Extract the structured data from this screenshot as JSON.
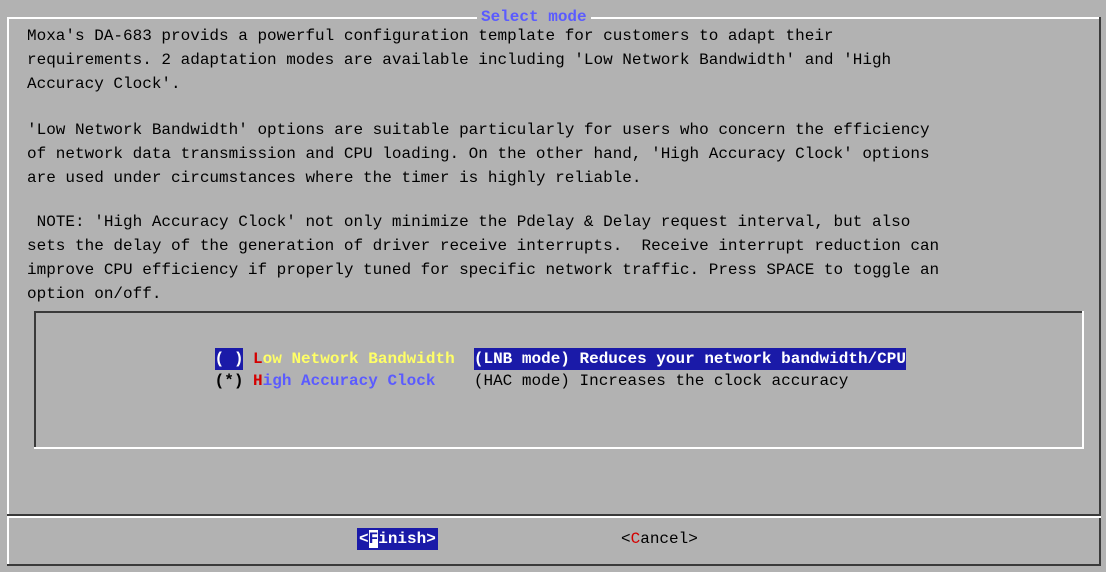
{
  "dialog": {
    "title": "Select mode",
    "paragraph1": "Moxa's DA-683 provids a powerful configuration template for customers to adapt their\nrequirements. 2 adaptation modes are available including 'Low Network Bandwidth' and 'High\nAccuracy Clock'.",
    "paragraph2": "'Low Network Bandwidth' options are suitable particularly for users who concern the efficiency\nof network data transmission and CPU loading. On the other hand, 'High Accuracy Clock' options\nare used under circumstances where the timer is highly reliable.",
    "paragraph3": " NOTE: 'High Accuracy Clock' not only minimize the Pdelay & Delay request interval, but also\nsets the delay of the generation of driver receive interrupts.  Receive interrupt reduction can\nimprove CPU efficiency if properly tuned for specific network traffic. Press SPACE to toggle an\noption on/off."
  },
  "options": [
    {
      "mark": "( )",
      "hotkey": "L",
      "label_rest": "ow Network Bandwidth",
      "description": "(LNB mode) Reduces your network bandwidth/CPU",
      "highlighted": true
    },
    {
      "mark": "(*)",
      "hotkey": "H",
      "label_rest": "igh Accuracy Clock",
      "description": "(HAC mode) Increases the clock accuracy",
      "highlighted": false
    }
  ],
  "buttons": {
    "finish": {
      "open": "<",
      "hotkey": "F",
      "rest": "inish>"
    },
    "cancel": {
      "open": "<",
      "hotkey": "C",
      "rest": "ancel>"
    }
  },
  "colors": {
    "background": "#b2b2b2",
    "highlight": "#1a1aa8",
    "hotkey": "#d40000",
    "title": "#5b5bff"
  }
}
